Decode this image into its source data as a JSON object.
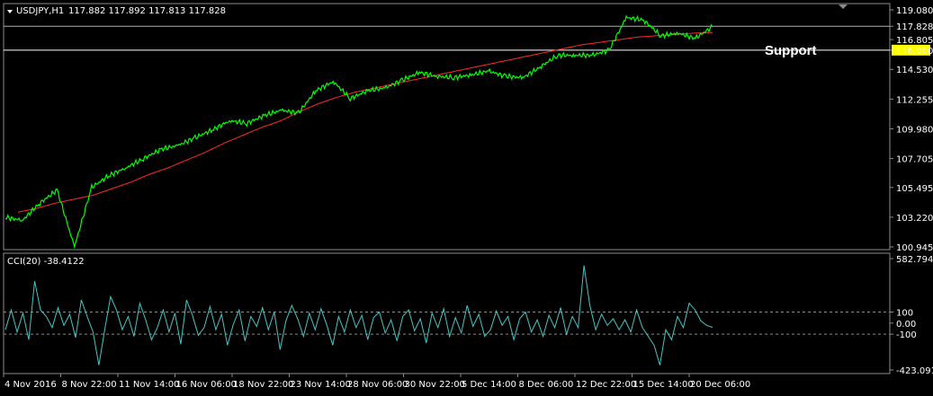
{
  "header": {
    "symbol_label": "USDJPY,H1",
    "ohlc_label": "117.882 117.892 117.813 117.828",
    "cci_label": "CCI(20) -38.4122"
  },
  "annotation": "Support",
  "colors": {
    "background": "#000000",
    "price": "#00ff00",
    "ma": "#ff2a2a",
    "cci": "#44c6c6",
    "grid": "#8c8c8c",
    "support_line": "#ffffff",
    "current_line": "#b0b0b0",
    "highlight_bg": "#ffff00"
  },
  "chart_data": [
    {
      "type": "line",
      "title": "USDJPY,H1",
      "x": [
        "4 Nov 2016",
        "8 Nov 22:00",
        "11 Nov 14:00",
        "16 Nov 06:00",
        "18 Nov 22:00",
        "23 Nov 14:00",
        "28 Nov 06:00",
        "30 Nov 22:00",
        "5 Dec 14:00",
        "8 Dec 06:00",
        "12 Dec 22:00",
        "15 Dec 14:00",
        "20 Dec 06:00"
      ],
      "ylim": [
        100.945,
        119.08
      ],
      "yticks": [
        119.08,
        117.828,
        116.805,
        116.0,
        114.53,
        112.255,
        109.98,
        107.705,
        105.495,
        103.22,
        100.945
      ],
      "current_price": 117.828,
      "support_level": 116.0,
      "series": [
        {
          "name": "price",
          "values": [
            103.2,
            103.0,
            104.3,
            105.3,
            100.95,
            105.5,
            106.4,
            107.0,
            107.7,
            108.4,
            108.7,
            109.3,
            109.9,
            110.6,
            110.4,
            111.0,
            111.4,
            111.2,
            112.9,
            113.6,
            112.3,
            112.9,
            113.1,
            113.7,
            114.3,
            114.0,
            113.9,
            114.1,
            114.4,
            114.0,
            113.9,
            114.7,
            115.6,
            115.6,
            115.6,
            116.0,
            118.5,
            118.3,
            117.1,
            117.3,
            116.9,
            117.8
          ]
        },
        {
          "name": "ma",
          "values": [
            103.6,
            103.9,
            104.3,
            104.6,
            104.9,
            105.4,
            105.9,
            106.5,
            107.0,
            107.6,
            108.2,
            108.9,
            109.5,
            110.1,
            110.6,
            111.3,
            111.9,
            112.4,
            112.8,
            113.1,
            113.4,
            113.7,
            114.0,
            114.3,
            114.6,
            114.9,
            115.2,
            115.5,
            115.8,
            116.1,
            116.4,
            116.6,
            116.8,
            117.0,
            117.1,
            117.2,
            117.3,
            117.35
          ]
        }
      ]
    },
    {
      "type": "line",
      "title": "CCI(20) -38.4122",
      "ylim": [
        -423.0918,
        582.7943
      ],
      "yticks": [
        582.7943,
        100,
        0.0,
        -100,
        -423.0918
      ],
      "levels": [
        100,
        -100
      ],
      "series": [
        {
          "name": "CCI(20)",
          "values": [
            -60,
            120,
            -80,
            90,
            -150,
            380,
            120,
            60,
            -40,
            140,
            -20,
            80,
            -130,
            210,
            60,
            -80,
            -380,
            -60,
            240,
            120,
            -60,
            60,
            -120,
            180,
            30,
            -150,
            -40,
            120,
            -80,
            90,
            -190,
            210,
            70,
            -110,
            -40,
            150,
            -60,
            80,
            -200,
            -10,
            120,
            -160,
            60,
            -30,
            140,
            -60,
            100,
            -240,
            20,
            160,
            40,
            -120,
            90,
            -60,
            130,
            -20,
            -200,
            60,
            -80,
            120,
            -40,
            70,
            -150,
            50,
            100,
            -90,
            30,
            -160,
            60,
            120,
            -70,
            40,
            -180,
            90,
            -40,
            130,
            -120,
            50,
            -90,
            160,
            -30,
            80,
            -120,
            -60,
            110,
            -20,
            60,
            -150,
            40,
            100,
            -80,
            30,
            -120,
            70,
            -40,
            140,
            -100,
            60,
            -40,
            520,
            160,
            -60,
            80,
            -20,
            40,
            -60,
            30,
            -80,
            120,
            -40,
            -120,
            -200,
            -380,
            -60,
            -150,
            60,
            -40,
            180,
            120,
            20,
            -20,
            -38.4
          ]
        }
      ]
    }
  ]
}
